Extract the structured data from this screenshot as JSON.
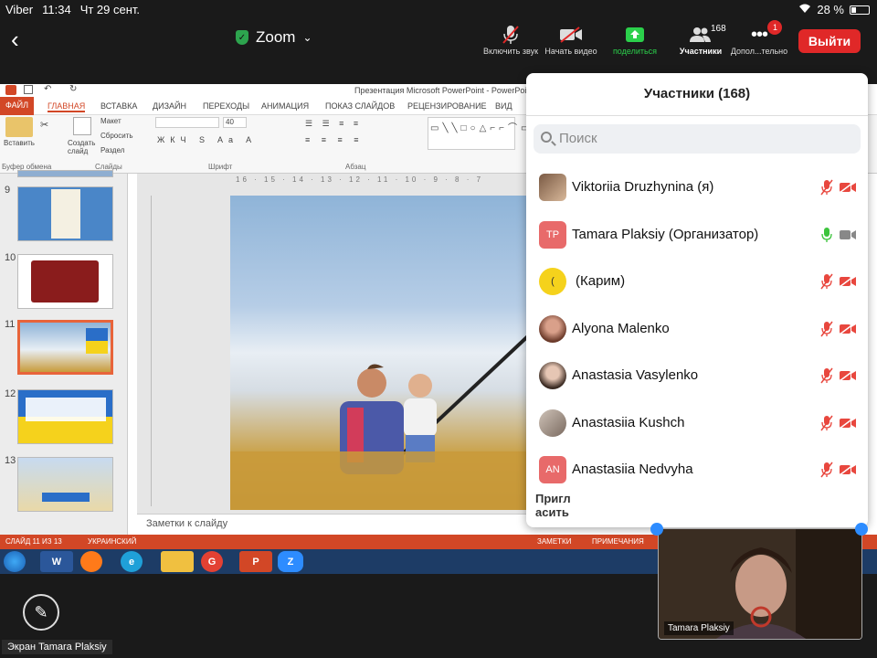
{
  "status": {
    "app": "Viber",
    "time": "11:34",
    "date": "Чт 29 сент.",
    "battery": "28 %"
  },
  "topbar": {
    "title": "Zoom",
    "mute_label": "Включить звук",
    "video_label": "Начать видео",
    "share_label": "поделиться",
    "participants_label": "Участники",
    "participants_count": "168",
    "more_label": "Допол...тельно",
    "more_badge": "1",
    "leave_label": "Выйти"
  },
  "ppt": {
    "window_title": "Презентация Microsoft PowerPoint - PowerPoint",
    "tabs": [
      "ФАЙЛ",
      "ГЛАВНАЯ",
      "ВСТАВКА",
      "ДИЗАЙН",
      "ПЕРЕХОДЫ",
      "АНИМАЦИЯ",
      "ПОКАЗ СЛАЙДОВ",
      "РЕЦЕНЗИРОВАНИЕ",
      "ВИД"
    ],
    "ribbon": {
      "paste": "Вставить",
      "create_slide": "Создать слайд",
      "layout": "Макет",
      "reset": "Сбросить",
      "section": "Раздел",
      "font_size": "40",
      "groups": [
        "Буфер обмена",
        "Слайды",
        "Шрифт",
        "Абзац"
      ]
    },
    "slide_numbers": [
      "9",
      "10",
      "11",
      "12",
      "13"
    ],
    "ruler": "16 · 15 · 14 · 13 · 12 · 11 · 10 · 9 · 8 · 7",
    "notes_placeholder": "Заметки к слайду",
    "status_slide": "СЛАЙД 11 ИЗ 13",
    "status_lang": "УКРАИНСКИЙ",
    "status_notes": "ЗАМЕТКИ",
    "status_comments": "ПРИМЕЧАНИЯ"
  },
  "taskbar": [
    "W",
    "e",
    "G",
    "P",
    "Z"
  ],
  "panel": {
    "title": "Участники (168)",
    "search_placeholder": "Поиск",
    "participants": [
      {
        "name": "Viktoriia Druzhynina (я)",
        "initials": "",
        "mic": "muted"
      },
      {
        "name": "Tamara Plaksiy (Организатор)",
        "initials": "TP",
        "mic": "on"
      },
      {
        "name": "(Карим)",
        "initials": "(",
        "mic": "muted"
      },
      {
        "name": "Alyona Malenko",
        "initials": "",
        "mic": "muted"
      },
      {
        "name": "Anastasia Vasylenko",
        "initials": "",
        "mic": "muted"
      },
      {
        "name": "Anastasiia Kushch",
        "initials": "",
        "mic": "muted"
      },
      {
        "name": "Anastasiia Nedvyha",
        "initials": "AN",
        "mic": "muted"
      }
    ],
    "invite": "Пригл\nасить"
  },
  "video": {
    "name": "Tamara Plaksiy"
  },
  "screen_label": "Экран Tamara Plaksiy",
  "colors": {
    "leave": "#e02828",
    "muted": "#e8473e",
    "mic_on": "#3cc43c",
    "share": "#2bd04b",
    "ppt_accent": "#d24726"
  }
}
